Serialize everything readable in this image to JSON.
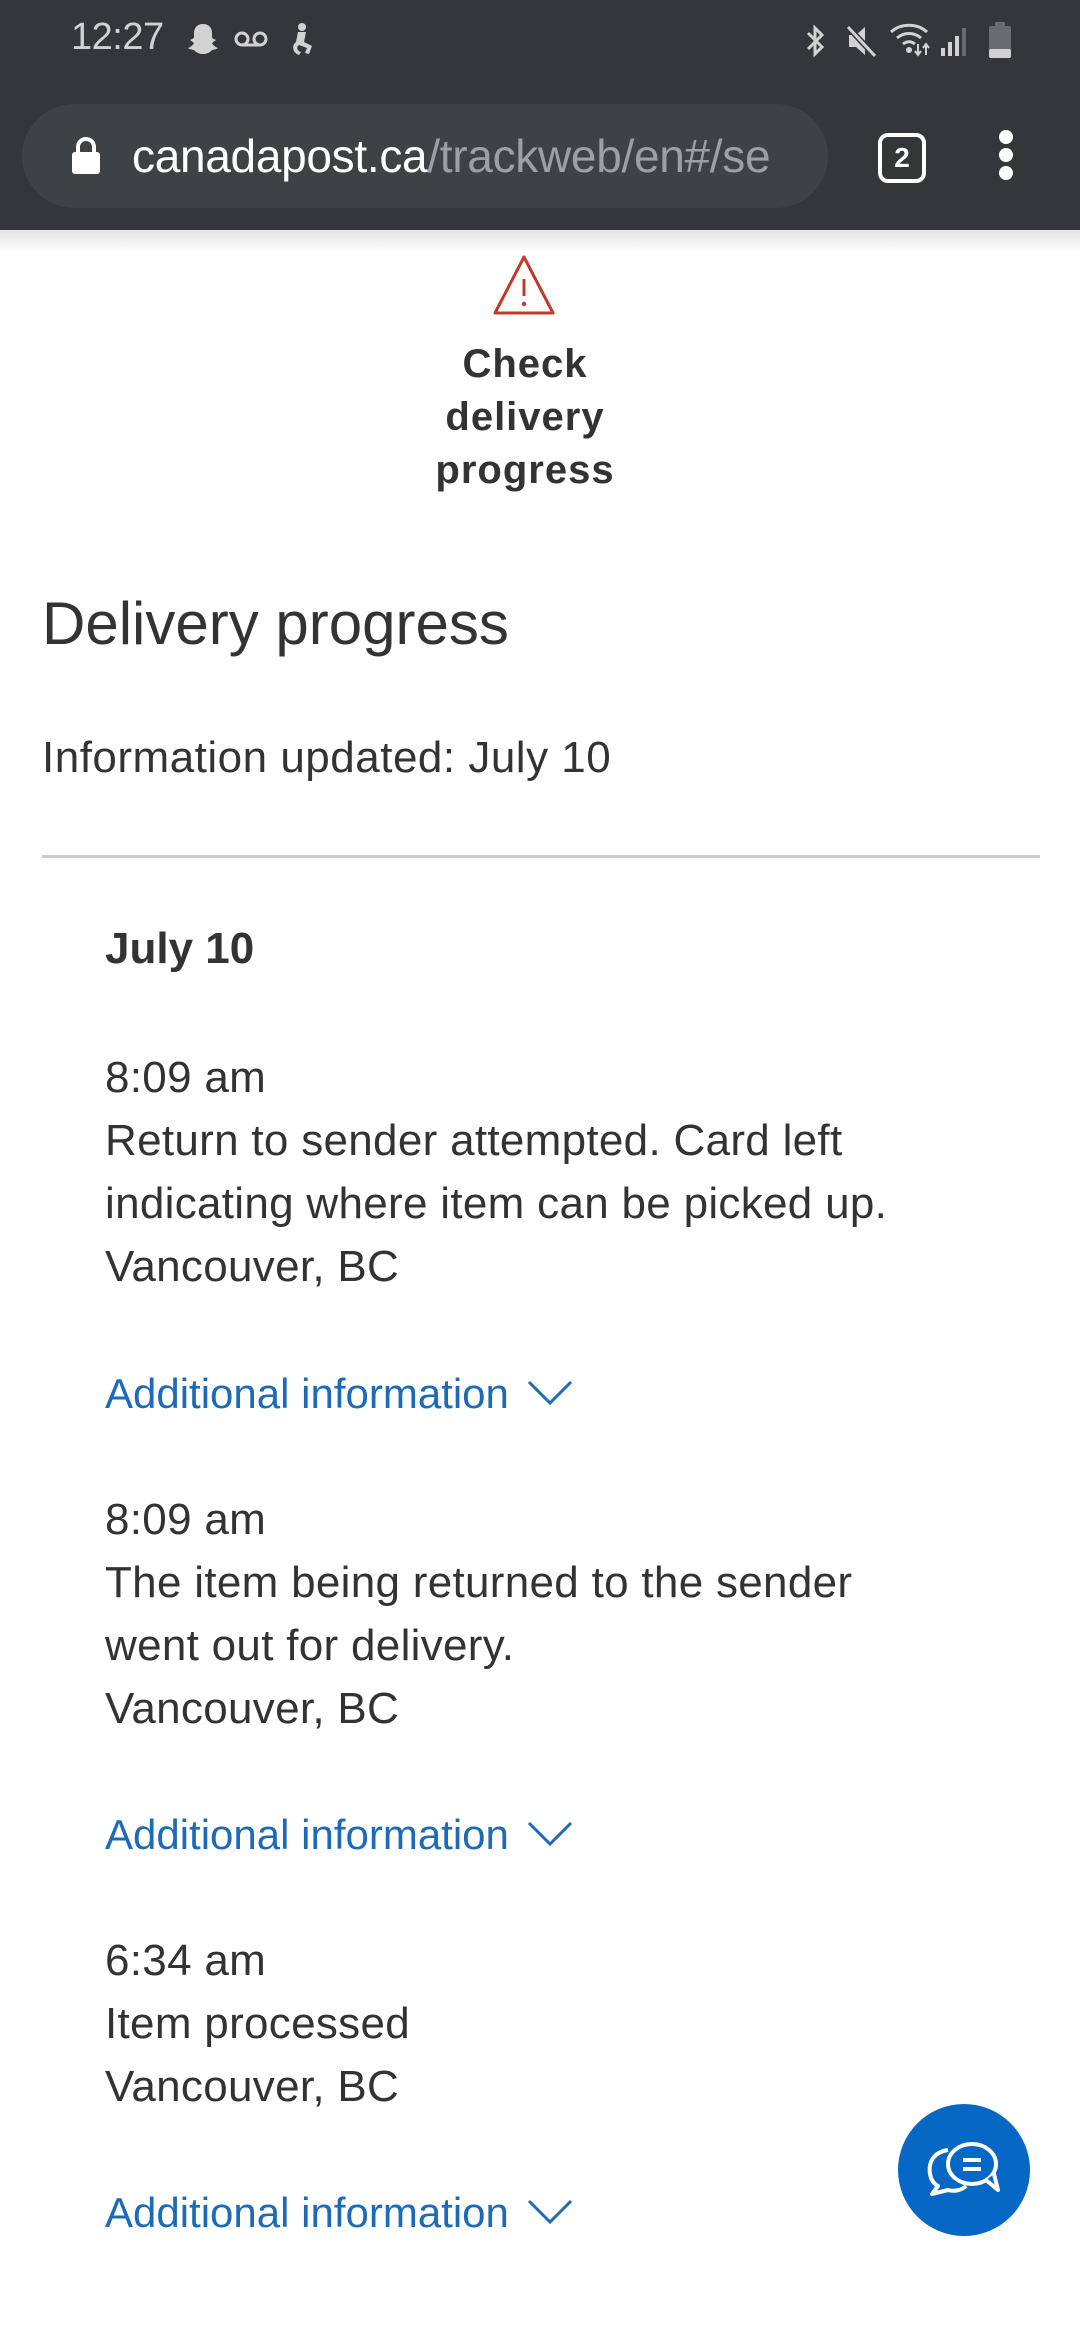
{
  "status_bar": {
    "time": "12:27",
    "left_icons": [
      "snapchat-icon",
      "voicemail-icon",
      "accessibility-icon"
    ],
    "right_icons": [
      "bluetooth-icon",
      "mute-icon",
      "wifi-icon",
      "signal-icon",
      "battery-icon"
    ]
  },
  "browser": {
    "url_domain": "canadapost.ca",
    "url_path": "/trackweb/en#/se",
    "tab_count": "2",
    "secure_icon": "lock-icon",
    "menu_icon": "more-vert-icon"
  },
  "page": {
    "alert": {
      "icon": "warning-icon",
      "title": "Check delivery progress",
      "color": "#c0392b"
    },
    "section_title": "Delivery progress",
    "info_updated": "Information updated: July 10",
    "days": [
      {
        "date": "July 10",
        "events": [
          {
            "time": "8:09 am",
            "description_lines": [
              "Return to sender attempted. Card left",
              "indicating where item can be picked up."
            ],
            "location": "Vancouver, BC",
            "link_label": "Additional information"
          },
          {
            "time": "8:09 am",
            "description_lines": [
              "The item being returned to the sender",
              "went out for delivery."
            ],
            "location": "Vancouver, BC",
            "link_label": "Additional information"
          },
          {
            "time": "6:34 am",
            "description_lines": [
              "Item processed"
            ],
            "location": "Vancouver, BC",
            "link_label": "Additional information"
          }
        ]
      }
    ]
  },
  "chat_button": {
    "icon": "chat-bubbles-icon",
    "color": "#0668c4"
  },
  "colors": {
    "link": "#1c6bb8",
    "text": "#333333",
    "chrome": "#35363a"
  }
}
